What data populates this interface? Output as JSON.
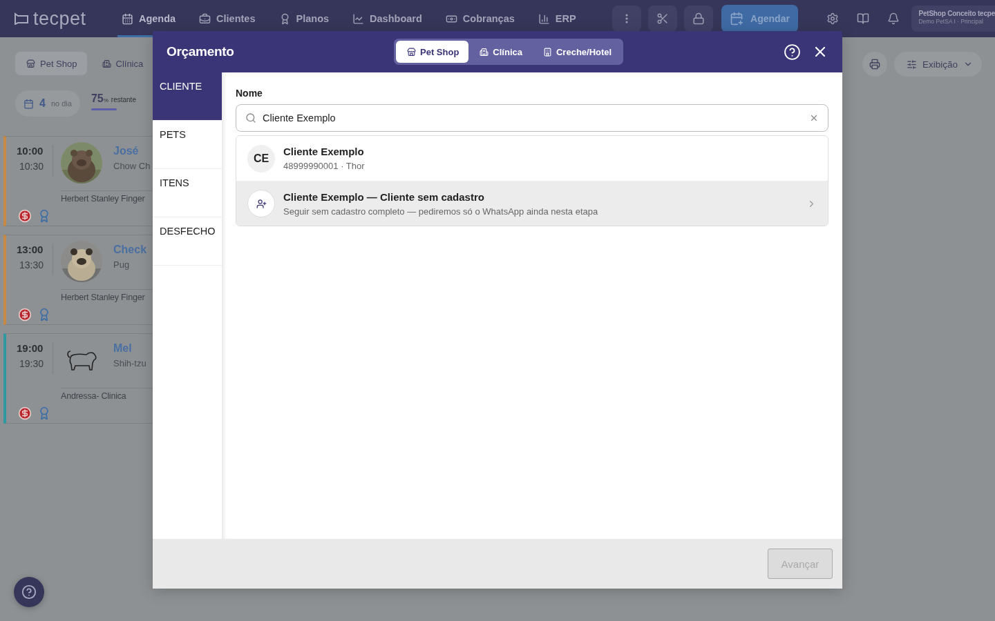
{
  "nav": {
    "logo": "tecpet",
    "items": [
      {
        "label": "Agenda",
        "selected": true
      },
      {
        "label": "Clientes",
        "selected": false
      },
      {
        "label": "Planos",
        "selected": false
      },
      {
        "label": "Dashboard",
        "selected": false
      },
      {
        "label": "Cobranças",
        "selected": false
      },
      {
        "label": "ERP",
        "selected": false
      }
    ],
    "primary": "Agendar",
    "account": {
      "name": "PetShop Conceito tecpe",
      "unit": "Demo PetSA I · Principal"
    }
  },
  "agenda": {
    "tabs": [
      {
        "label": "Pet Shop",
        "selected": true
      },
      {
        "label": "Clínica",
        "selected": false
      }
    ],
    "stats": {
      "count": "4",
      "count_label": "no dia",
      "percent": "75",
      "percent_unit": "%",
      "percent_label": "restante"
    },
    "appointments": [
      {
        "start": "10:00",
        "end": "10:30",
        "pet": "José",
        "breed": "Chow Ch",
        "owner": "Herbert Stanley Finger",
        "color": "#c68a45"
      },
      {
        "start": "13:00",
        "end": "13:30",
        "pet": "Check",
        "breed": "Pug",
        "owner": "Herbert Stanley Finger",
        "color": "#c68a45"
      },
      {
        "kind": "icon",
        "start": "19:00",
        "end": "19:30",
        "pet": "Mel",
        "breed": "Shih-tzu",
        "owner": "Andressa- Clinica",
        "color": "#2e98a3"
      }
    ],
    "view_button": "Exibição"
  },
  "modal": {
    "title": "Orçamento",
    "tabs": [
      {
        "label": "Pet Shop",
        "selected": true
      },
      {
        "label": "Clínica",
        "selected": false
      },
      {
        "label": "Creche/Hotel",
        "selected": false
      }
    ],
    "steps": [
      {
        "label": "CLIENTE",
        "selected": true
      },
      {
        "label": "PETS",
        "selected": false
      },
      {
        "label": "ITENS",
        "selected": false
      },
      {
        "label": "DESFECHO",
        "selected": false
      }
    ],
    "field_label": "Nome",
    "search_value": "Cliente Exemplo",
    "results": [
      {
        "kind": "client",
        "initials": "CE",
        "title": "Cliente Exemplo",
        "subtitle": "48999990001 · Thor",
        "highlighted": false
      },
      {
        "kind": "new",
        "title": "Cliente Exemplo — Cliente sem cadastro",
        "subtitle": "Seguir sem cadastro completo — pediremos só o WhatsApp ainda nesta etapa",
        "highlighted": true
      }
    ],
    "next_button": {
      "label": "Avançar",
      "disabled": true
    }
  }
}
